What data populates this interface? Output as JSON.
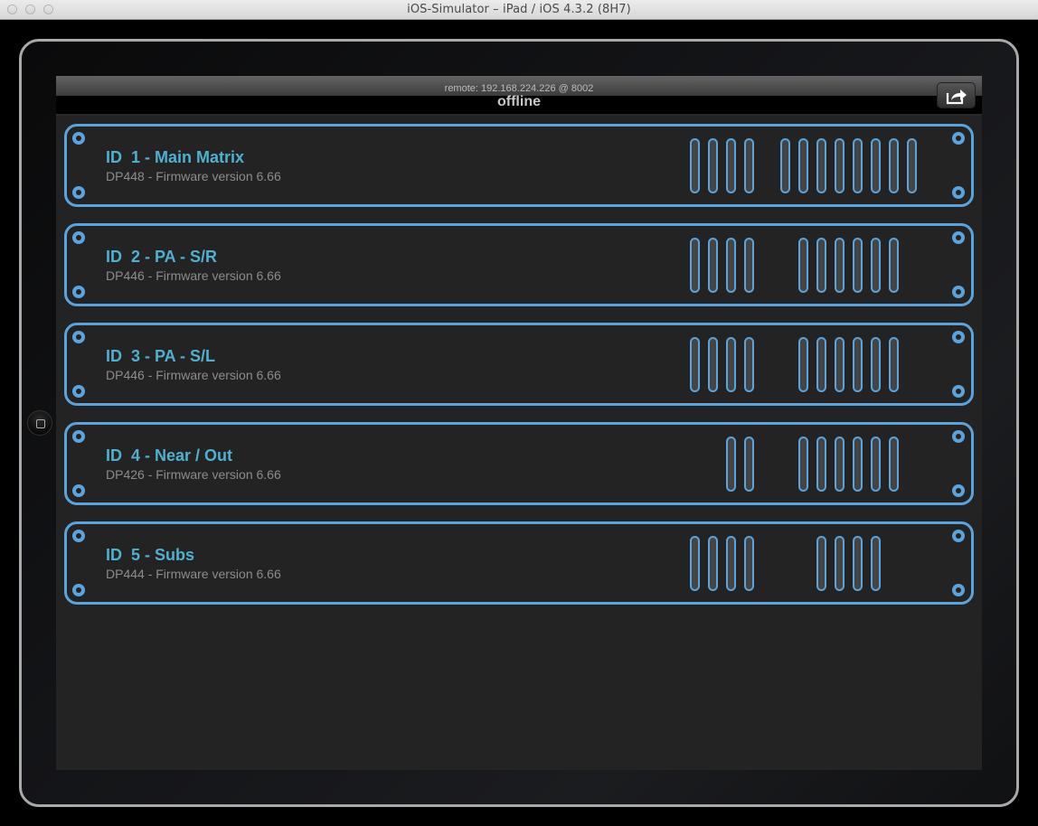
{
  "window": {
    "title": "iOS-Simulator – iPad / iOS 4.3.2 (8H7)",
    "buttons": [
      "close",
      "minimize",
      "zoom"
    ]
  },
  "navbar": {
    "remote": "remote: 192.168.224.226 @ 8002",
    "status": "offline",
    "share_icon": "share-icon"
  },
  "colors": {
    "accent": "#5aa3dc",
    "title_text": "#4fb0d0",
    "subtitle_text": "#8c8c8c",
    "background": "#232323"
  },
  "devices": [
    {
      "name": "ID  1 - Main Matrix",
      "subtitle": "DP448 - Firmware version 6.66",
      "inputs": 4,
      "outputs": 8
    },
    {
      "name": "ID  2 - PA - S/R",
      "subtitle": "DP446 - Firmware version 6.66",
      "inputs": 4,
      "outputs": 6
    },
    {
      "name": "ID  3 - PA - S/L",
      "subtitle": "DP446 - Firmware version 6.66",
      "inputs": 4,
      "outputs": 6
    },
    {
      "name": "ID  4 - Near / Out",
      "subtitle": "DP426 - Firmware version 6.66",
      "inputs": 2,
      "outputs": 6
    },
    {
      "name": "ID  5 - Subs",
      "subtitle": "DP444 - Firmware version 6.66",
      "inputs": 4,
      "outputs": 4
    }
  ]
}
